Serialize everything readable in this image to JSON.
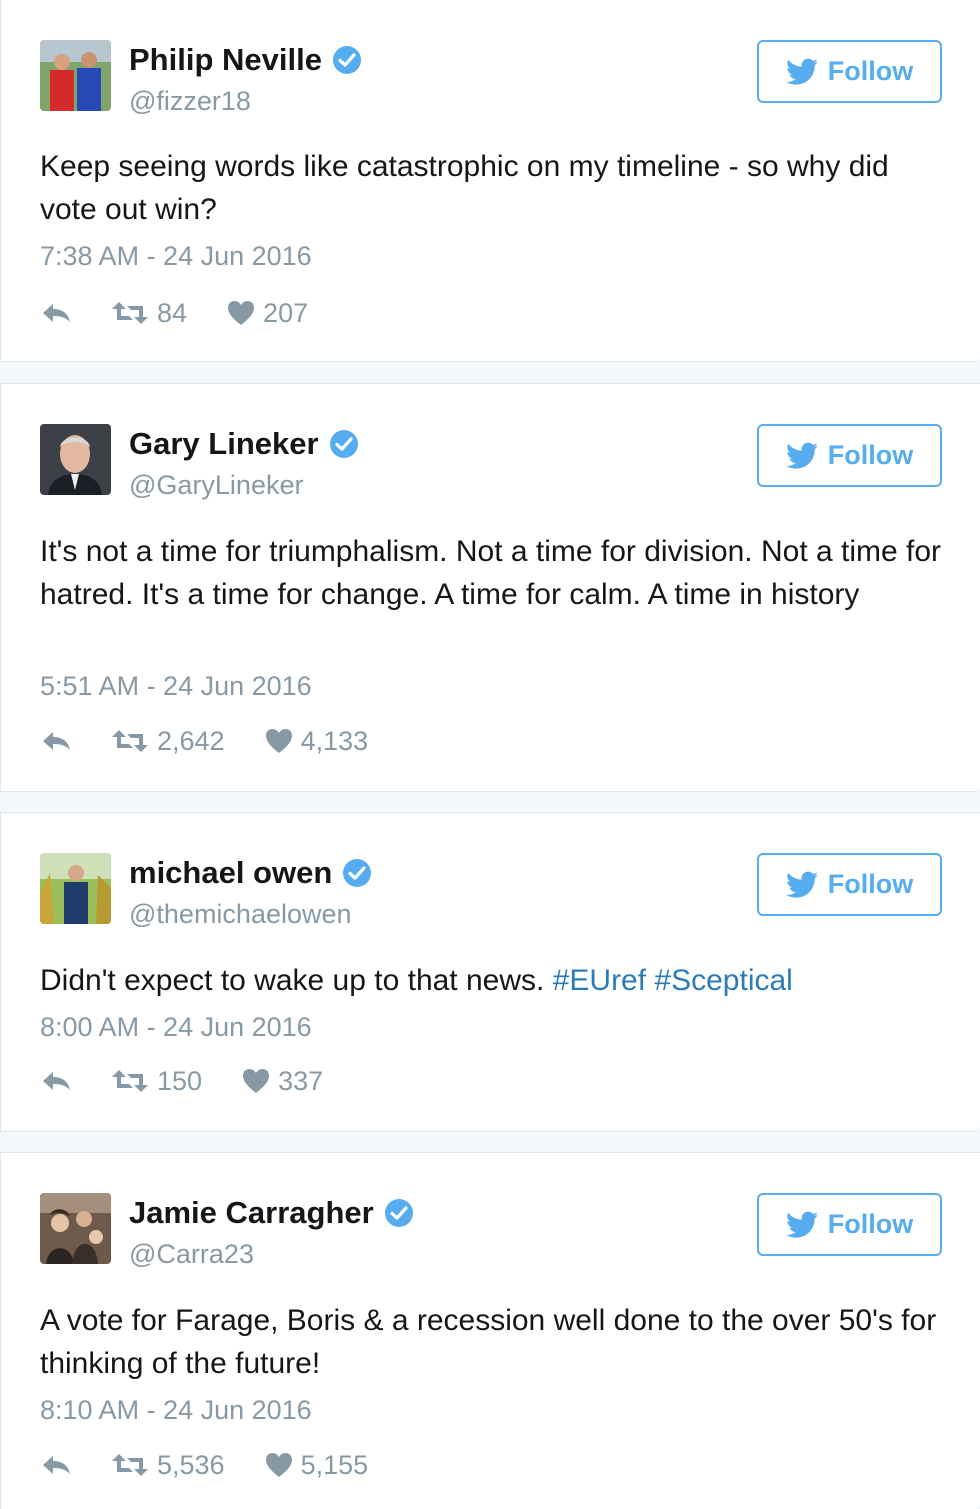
{
  "follow_label": "Follow",
  "colors": {
    "accent": "#55acee",
    "verified": "#55acee",
    "hashtag": "#2b7bb9",
    "meta": "#8899a6"
  },
  "tweets": [
    {
      "name": "Philip Neville",
      "handle": "@fizzer18",
      "text": "Keep seeing words like catastrophic on my timeline - so why did vote out win?",
      "time": "7:38 AM - 24 Jun 2016",
      "retweets": "84",
      "likes": "207"
    },
    {
      "name": "Gary Lineker",
      "handle": "@GaryLineker",
      "text": "It's not a time for triumphalism. Not a time for division. Not a time for hatred. It's a time for change. A time for calm. A time in history",
      "time": "5:51 AM - 24 Jun 2016",
      "retweets": "2,642",
      "likes": "4,133"
    },
    {
      "name": "michael owen",
      "handle": "@themichaelowen",
      "text": "Didn't expect to wake up to that news.",
      "hashtags": [
        "#EUref",
        "#Sceptical"
      ],
      "time": "8:00 AM - 24 Jun 2016",
      "retweets": "150",
      "likes": "337"
    },
    {
      "name": "Jamie Carragher",
      "handle": "@Carra23",
      "text": "A vote for Farage, Boris & a recession well done to the over 50's for thinking of the future!",
      "time": "8:10 AM - 24 Jun 2016",
      "retweets": "5,536",
      "likes": "5,155"
    }
  ]
}
